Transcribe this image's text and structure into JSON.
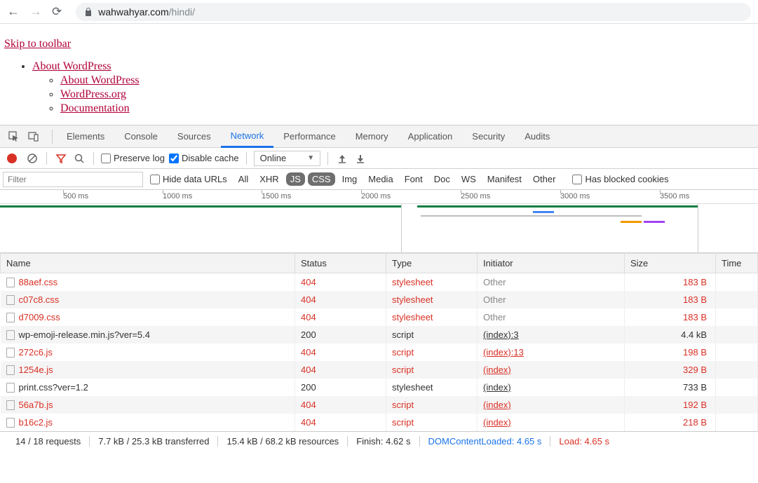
{
  "browser": {
    "url_host": "wahwahyar.com",
    "url_path": "/hindi/"
  },
  "page": {
    "skip_link": "Skip to toolbar",
    "about_wp": "About WordPress",
    "about_wp_sub": "About WordPress",
    "wp_org": "WordPress.org",
    "documentation": "Documentation"
  },
  "devtools": {
    "tabs": [
      "Elements",
      "Console",
      "Sources",
      "Network",
      "Performance",
      "Memory",
      "Application",
      "Security",
      "Audits"
    ],
    "active_tab": "Network",
    "toolbar": {
      "preserve_log": "Preserve log",
      "disable_cache": "Disable cache",
      "throttle": "Online"
    },
    "filter": {
      "placeholder": "Filter",
      "hide_urls": "Hide data URLs",
      "types": [
        "All",
        "XHR",
        "JS",
        "CSS",
        "Img",
        "Media",
        "Font",
        "Doc",
        "WS",
        "Manifest",
        "Other"
      ],
      "active_types": [
        "JS",
        "CSS"
      ],
      "blocked": "Has blocked cookies"
    },
    "timeline_ticks": [
      "500 ms",
      "1000 ms",
      "1500 ms",
      "2000 ms",
      "2500 ms",
      "3000 ms",
      "3500 ms"
    ],
    "columns": {
      "name": "Name",
      "status": "Status",
      "type": "Type",
      "initiator": "Initiator",
      "size": "Size",
      "time": "Time"
    },
    "rows": [
      {
        "name": "88aef.css",
        "status": "404",
        "type": "stylesheet",
        "initiator": "Other",
        "initiator_link": false,
        "size": "183 B",
        "err": true
      },
      {
        "name": "c07c8.css",
        "status": "404",
        "type": "stylesheet",
        "initiator": "Other",
        "initiator_link": false,
        "size": "183 B",
        "err": true
      },
      {
        "name": "d7009.css",
        "status": "404",
        "type": "stylesheet",
        "initiator": "Other",
        "initiator_link": false,
        "size": "183 B",
        "err": true
      },
      {
        "name": "wp-emoji-release.min.js?ver=5.4",
        "status": "200",
        "type": "script",
        "initiator": "(index):3",
        "initiator_link": true,
        "size": "4.4 kB",
        "err": false
      },
      {
        "name": "272c6.js",
        "status": "404",
        "type": "script",
        "initiator": "(index):13",
        "initiator_link": true,
        "size": "198 B",
        "err": true
      },
      {
        "name": "1254e.js",
        "status": "404",
        "type": "script",
        "initiator": "(index)",
        "initiator_link": true,
        "size": "329 B",
        "err": true
      },
      {
        "name": "print.css?ver=1.2",
        "status": "200",
        "type": "stylesheet",
        "initiator": "(index)",
        "initiator_link": true,
        "size": "733 B",
        "err": false
      },
      {
        "name": "56a7b.js",
        "status": "404",
        "type": "script",
        "initiator": "(index)",
        "initiator_link": true,
        "size": "192 B",
        "err": true
      },
      {
        "name": "b16c2.js",
        "status": "404",
        "type": "script",
        "initiator": "(index)",
        "initiator_link": true,
        "size": "218 B",
        "err": true
      }
    ],
    "status": {
      "requests": "14 / 18 requests",
      "transferred": "7.7 kB / 25.3 kB transferred",
      "resources": "15.4 kB / 68.2 kB resources",
      "finish": "Finish: 4.62 s",
      "dcl": "DOMContentLoaded: 4.65 s",
      "load": "Load: 4.65 s"
    }
  }
}
